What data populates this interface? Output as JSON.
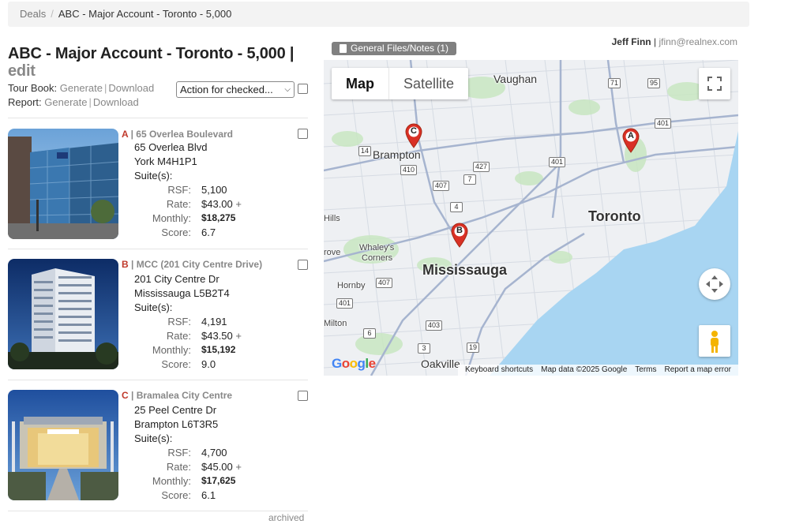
{
  "breadcrumb": {
    "root": "Deals",
    "separator": "/",
    "current": "ABC - Major Account - Toronto - 5,000"
  },
  "title": {
    "main": "ABC - Major Account - Toronto - 5,000 |",
    "edit": "edit"
  },
  "tour_book": {
    "label": "Tour Book:",
    "generate": "Generate",
    "download": "Download"
  },
  "report": {
    "label": "Report:",
    "generate": "Generate",
    "download": "Download"
  },
  "action_select": {
    "selected": "Action for checked..."
  },
  "user": {
    "name": "Jeff Finn",
    "separator": "|",
    "email": "jfinn@realnex.com"
  },
  "files_button": {
    "label": "General Files/Notes (1)"
  },
  "labels": {
    "suites": "Suite(s):",
    "rsf": "RSF:",
    "rate": "Rate:",
    "monthly": "Monthly:",
    "score": "Score:",
    "plus": "+"
  },
  "properties": [
    {
      "letter": "A",
      "name": "| 65 Overlea Boulevard",
      "street": "65 Overlea Blvd",
      "city": "York M4H1P1",
      "rsf": "5,100",
      "rate": "$43.00",
      "monthly": "$18,275",
      "score": "6.7"
    },
    {
      "letter": "B",
      "name": "| MCC (201 City Centre Drive)",
      "street": "201 City Centre Dr",
      "city": "Mississauga L5B2T4",
      "rsf": "4,191",
      "rate": "$43.50",
      "monthly": "$15,192",
      "score": "9.0"
    },
    {
      "letter": "C",
      "name": "| Bramalea City Centre",
      "street": "25 Peel Centre Dr",
      "city": "Brampton L6T3R5",
      "rsf": "4,700",
      "rate": "$45.00",
      "monthly": "$17,625",
      "score": "6.1"
    }
  ],
  "archived": "archived",
  "map": {
    "tab_map": "Map",
    "tab_satellite": "Satellite",
    "places": {
      "vaughan": "Vaughan",
      "brampton": "Brampton",
      "toronto": "Toronto",
      "mississauga": "Mississauga",
      "hills": "Hills",
      "grove": "rove",
      "whaleys": "Whaley's",
      "corners": "Corners",
      "hornby": "Hornby",
      "milton": "Milton",
      "oakville": "Oakville"
    },
    "shields": {
      "s71": "71",
      "s95": "95",
      "s401a": "401",
      "s401b": "401",
      "s401c": "401",
      "s14": "14",
      "s410": "410",
      "s427": "427",
      "s7": "7",
      "s407a": "407",
      "s407b": "407",
      "s4": "4",
      "s403": "403",
      "s6": "6",
      "s3": "3",
      "s19": "19"
    },
    "pins": {
      "a": "A",
      "b": "B",
      "c": "C"
    },
    "footer": {
      "shortcuts": "Keyboard shortcuts",
      "data": "Map data ©2025 Google",
      "terms": "Terms",
      "report": "Report a map error"
    },
    "google": "Google",
    "colors": {
      "water": "#a8d5f2",
      "land": "#eef0f3",
      "park": "#c8e6c1",
      "road": "#a6b4cf",
      "pin": "#d93025"
    }
  }
}
